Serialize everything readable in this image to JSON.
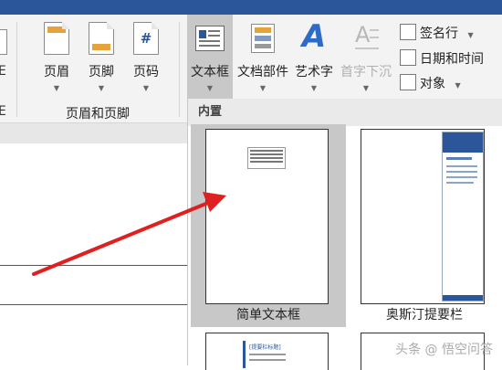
{
  "ribbon": {
    "header_footer_group": {
      "label": "页眉和页脚",
      "buttons": [
        {
          "label": "页眉",
          "icon": "header-icon"
        },
        {
          "label": "页脚",
          "icon": "footer-icon"
        },
        {
          "label": "页码",
          "icon": "page-number-icon",
          "glyph": "#"
        }
      ]
    },
    "left_partial_labels": [
      "E",
      "E"
    ],
    "text_group": {
      "buttons": [
        {
          "label": "文本框",
          "icon": "text-box-icon"
        },
        {
          "label": "文档部件",
          "icon": "quick-parts-icon"
        },
        {
          "label": "艺术字",
          "icon": "wordart-icon",
          "glyph": "A"
        },
        {
          "label": "首字下沉",
          "icon": "drop-cap-icon",
          "glyph": "A",
          "disabled": true
        }
      ],
      "small_buttons": [
        {
          "label": "签名行",
          "icon": "signature-line-icon"
        },
        {
          "label": "日期和时间",
          "icon": "date-time-icon"
        },
        {
          "label": "对象",
          "icon": "object-icon"
        }
      ]
    }
  },
  "gallery": {
    "section_title": "内置",
    "tiles": [
      {
        "caption": "简单文本框",
        "selected": true
      },
      {
        "caption": "奥斯汀提要栏",
        "selected": false
      }
    ],
    "partial_thumb_text": "[提要栏标题]"
  },
  "watermark": "头条 @ 悟空问答",
  "colors": {
    "accent": "#2b579a",
    "arrow": "#e02020",
    "wordart": "#2e6bc6",
    "footer_band": "#e8a23a",
    "sidebar_band": "#2b579a"
  }
}
